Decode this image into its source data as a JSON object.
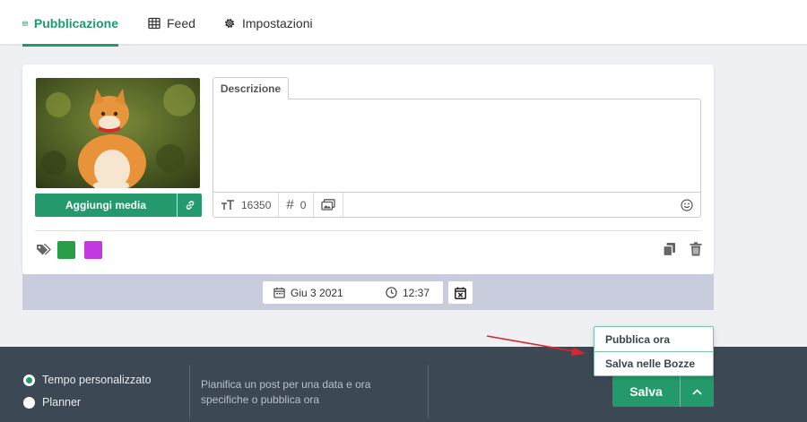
{
  "tabs": [
    {
      "label": "Pubblicazione",
      "icon": "calendar-icon",
      "active": true
    },
    {
      "label": "Feed",
      "icon": "table-grid-icon",
      "active": false
    },
    {
      "label": "Impostazioni",
      "icon": "gear-icon",
      "active": false
    }
  ],
  "media": {
    "image": "cat-photo",
    "add_media_label": "Aggiungi media",
    "link_icon": "link-icon"
  },
  "description": {
    "tab_label": "Descrizione",
    "value": "",
    "char_count": "16350",
    "hashtag_count": "0"
  },
  "tags": {
    "colors": [
      "#2a9d48",
      "#c338e0"
    ]
  },
  "schedule": {
    "date": "Giu 3 2021",
    "time": "12:37"
  },
  "bottom": {
    "options": [
      {
        "label": "Tempo personalizzato",
        "selected": true
      },
      {
        "label": "Planner",
        "selected": false
      }
    ],
    "info_text": "Pianifica un post per una data e ora specifiche o pubblica ora",
    "save_label": "Salva",
    "menu": [
      "Pubblica ora",
      "Salva nelle Bozze"
    ]
  },
  "colors": {
    "accent": "#1e9a6e",
    "button": "#249a6c",
    "bottom_bar": "#3d4855",
    "annotation_arrow": "#e0242b"
  }
}
